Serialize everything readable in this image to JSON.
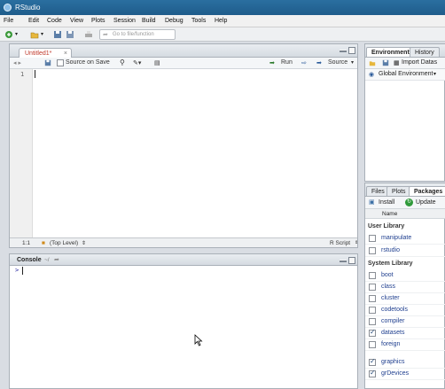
{
  "window": {
    "title": "RStudio"
  },
  "menu": [
    "File",
    "Edit",
    "Code",
    "View",
    "Plots",
    "Session",
    "Build",
    "Debug",
    "Tools",
    "Help"
  ],
  "toolbar": {
    "goto_placeholder": "Go to file/function"
  },
  "editor": {
    "tab_label": "Untitled1*",
    "tab_close": "×",
    "source_on_save": "Source on Save",
    "run": "Run",
    "source": "Source",
    "line_number": "1",
    "status": {
      "position": "1:1",
      "scope": "(Top Level)",
      "file_type": "R Script"
    }
  },
  "console": {
    "title": "Console",
    "path": "~/",
    "prompt": ">"
  },
  "environment": {
    "tabs": [
      "Environment",
      "History"
    ],
    "import_label": "Import Datas",
    "scope_label": "Global Environment"
  },
  "packages": {
    "tabs": [
      "Files",
      "Plots",
      "Packages"
    ],
    "install": "Install",
    "update": "Update",
    "name_header": "Name",
    "user_library_title": "User Library",
    "system_library_title": "System Library",
    "user_library": [
      {
        "name": "manipulate",
        "checked": false
      },
      {
        "name": "rstudio",
        "checked": false
      }
    ],
    "system_library": [
      {
        "name": "boot",
        "checked": false
      },
      {
        "name": "class",
        "checked": false
      },
      {
        "name": "cluster",
        "checked": false
      },
      {
        "name": "codetools",
        "checked": false
      },
      {
        "name": "compiler",
        "checked": false
      },
      {
        "name": "datasets",
        "checked": true
      },
      {
        "name": "foreign",
        "checked": false
      },
      {
        "name": "graphics",
        "checked": true
      },
      {
        "name": "grDevices",
        "checked": true
      }
    ]
  },
  "colors": {
    "titlebar": "#2a6fa0",
    "accent": "#1f3f8f",
    "tab_modified": "#c0392b"
  }
}
